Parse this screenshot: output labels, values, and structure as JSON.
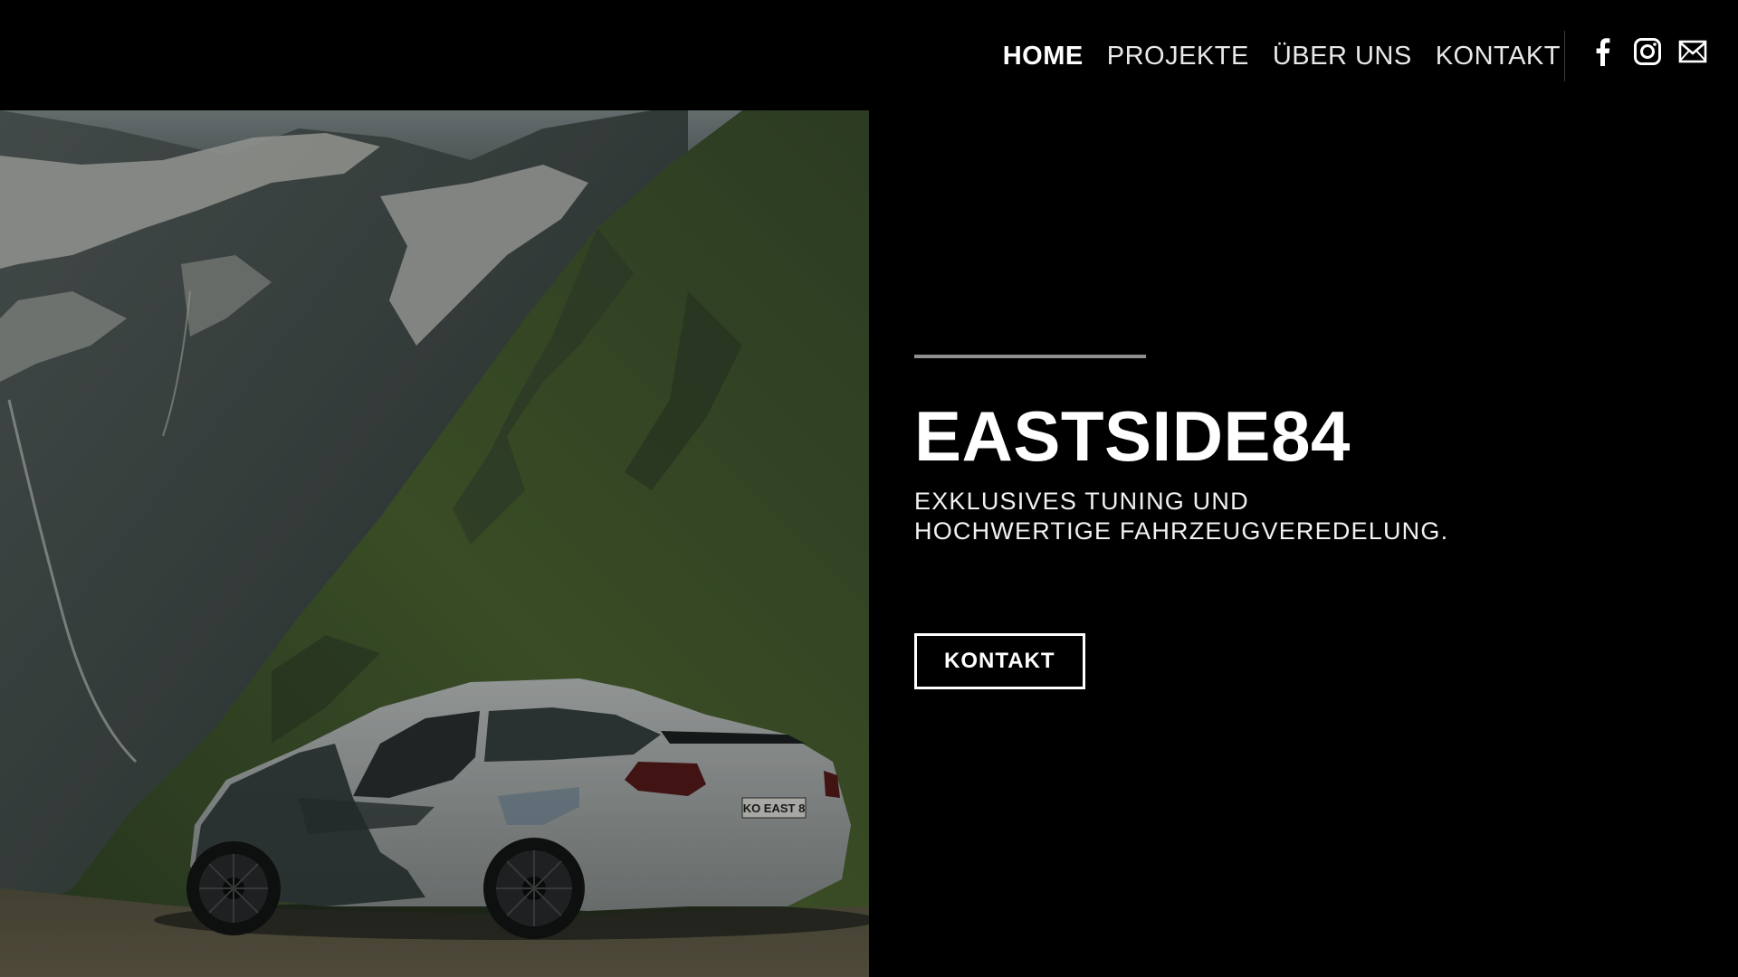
{
  "header": {
    "nav": [
      {
        "label": "HOME",
        "active": true
      },
      {
        "label": "PROJEKTE",
        "active": false
      },
      {
        "label": "ÜBER UNS",
        "active": false
      },
      {
        "label": "KONTAKT",
        "active": false
      }
    ],
    "social": [
      "facebook-icon",
      "instagram-icon",
      "mail-icon"
    ]
  },
  "hero": {
    "title": "EASTSIDE84",
    "subtitle_line1": "EXKLUSIVES TUNING UND",
    "subtitle_line2": "HOCHWERTIGE FAHRZEUGVEREDELUNG.",
    "cta_label": "KONTAKT",
    "plate": "KO EAST 8"
  },
  "colors": {
    "background": "#000000",
    "text": "#ffffff",
    "rule": "#8f8f8f"
  }
}
